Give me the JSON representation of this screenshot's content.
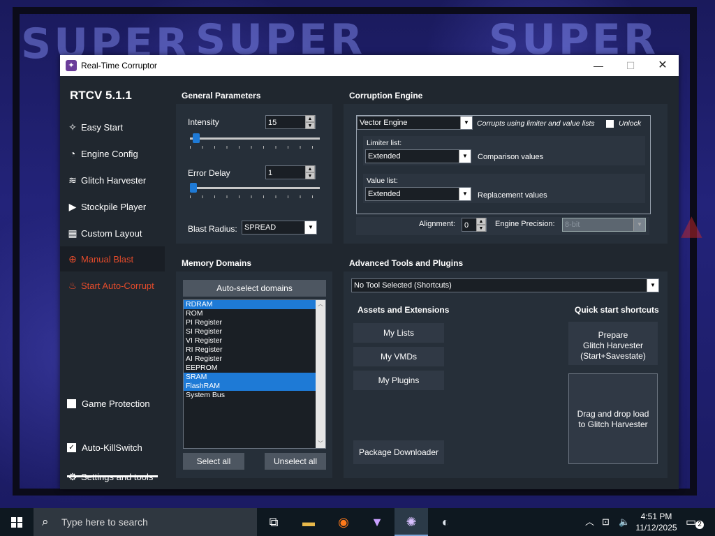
{
  "window": {
    "title": "Real-Time Corruptor"
  },
  "sidebar": {
    "version": "RTCV 5.1.1",
    "items": [
      {
        "label": "Easy Start",
        "icon": "wand-icon"
      },
      {
        "label": "Engine Config",
        "icon": "gauge-icon"
      },
      {
        "label": "Glitch Harvester",
        "icon": "layers-icon"
      },
      {
        "label": "Stockpile Player",
        "icon": "play-icon"
      },
      {
        "label": "Custom Layout",
        "icon": "grid-icon"
      },
      {
        "label": "Manual Blast",
        "icon": "crosshair-icon"
      },
      {
        "label": "Start Auto-Corrupt",
        "icon": "flame-icon"
      }
    ],
    "game_protection": {
      "label": "Game Protection",
      "checked": false
    },
    "auto_killswitch": {
      "label": "Auto-KillSwitch",
      "checked": true
    },
    "settings": {
      "label": "Settings and tools",
      "icon": "gear-icon"
    }
  },
  "general": {
    "header": "General Parameters",
    "intensity_label": "Intensity",
    "intensity_value": "15",
    "intensity_level": 0.02,
    "error_delay_label": "Error Delay",
    "error_delay_value": "1",
    "error_delay_level": 0.0,
    "blast_radius_label": "Blast Radius:",
    "blast_radius_value": "SPREAD"
  },
  "engine": {
    "header": "Corruption Engine",
    "engine_value": "Vector Engine",
    "description": "Corrupts using limiter and value lists",
    "unlock_label": "Unlock",
    "limiter_label": "Limiter list:",
    "limiter_value": "Extended",
    "limiter_desc": "Comparison values",
    "value_label": "Value list:",
    "value_value": "Extended",
    "value_desc": "Replacement values",
    "alignment_label": "Alignment:",
    "alignment_value": "0",
    "precision_label": "Engine Precision:",
    "precision_value": "8-bit"
  },
  "memory": {
    "header": "Memory Domains",
    "autoselect_label": "Auto-select domains",
    "domains": [
      {
        "name": "RDRAM",
        "selected": true
      },
      {
        "name": "ROM",
        "selected": false
      },
      {
        "name": "PI Register",
        "selected": false
      },
      {
        "name": "SI Register",
        "selected": false
      },
      {
        "name": "VI Register",
        "selected": false
      },
      {
        "name": "RI Register",
        "selected": false
      },
      {
        "name": "AI Register",
        "selected": false
      },
      {
        "name": "EEPROM",
        "selected": false
      },
      {
        "name": "SRAM",
        "selected": true
      },
      {
        "name": "FlashRAM",
        "selected": true
      },
      {
        "name": "System Bus",
        "selected": false
      }
    ],
    "select_all": "Select all",
    "unselect_all": "Unselect all"
  },
  "advanced": {
    "header": "Advanced Tools and Plugins",
    "tool_dropdown": "No Tool Selected (Shortcuts)",
    "assets_header": "Assets and Extensions",
    "my_lists": "My Lists",
    "my_vmds": "My VMDs",
    "my_plugins": "My Plugins",
    "package_downloader": "Package Downloader",
    "quick_header": "Quick start shortcuts",
    "prepare_line1": "Prepare",
    "prepare_line2": "Glitch Harvester",
    "prepare_line3": "(Start+Savestate)",
    "drag_line1": "Drag and drop load",
    "drag_line2": "to Glitch Harvester"
  },
  "taskbar": {
    "search_placeholder": "Type here to search",
    "time": "4:51 PM",
    "date": "11/12/2025",
    "notifications": "2"
  },
  "desktop": {
    "bg_text": "SUPER"
  }
}
